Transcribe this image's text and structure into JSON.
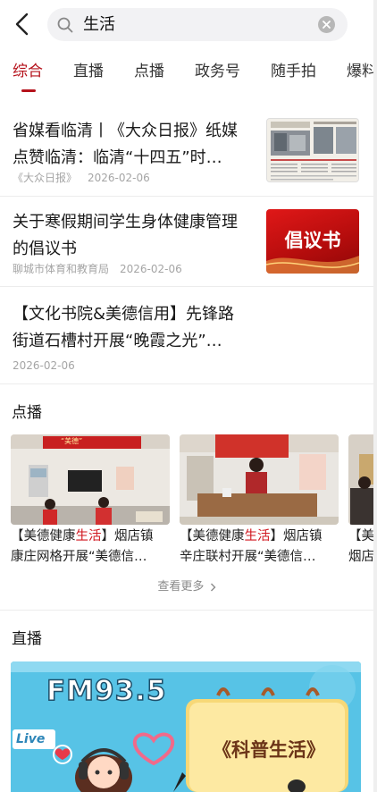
{
  "search": {
    "query": "生活"
  },
  "tabs": [
    {
      "label": "综合"
    },
    {
      "label": "直播"
    },
    {
      "label": "点播"
    },
    {
      "label": "政务号"
    },
    {
      "label": "随手拍"
    },
    {
      "label": "爆料"
    }
  ],
  "news": [
    {
      "title_line1": "省媒看临清丨《大众日报》纸媒",
      "title_line2": "点赞临清：临清“十四五”时…",
      "source": "《大众日报》",
      "date": "2026-02-06"
    },
    {
      "title_line1": "关于寒假期间学生身体健康管理",
      "title_line2": "的倡议书",
      "source": "聊城市体育和教育局",
      "date": "2026-02-06",
      "thumb_text": "倡议书"
    },
    {
      "title_line1": "【文化书院&美德信用】先锋路",
      "title_line2": "街道石槽村开展“晚霞之光”…",
      "date": "2026-02-06"
    }
  ],
  "vod": {
    "heading": "点播",
    "more_label": "查看更多",
    "items": [
      {
        "prefix": "【美德健康",
        "highlight": "生活",
        "suffix": "】烟店镇",
        "line2": "康庄网格开展“美德信…",
        "banner": "“美德”"
      },
      {
        "prefix": "【美德健康",
        "highlight": "生活",
        "suffix": "】烟店镇",
        "line2": "辛庄联村开展“美德信…"
      },
      {
        "prefix": "【美",
        "highlight": "",
        "suffix": "",
        "line2": "烟店"
      }
    ]
  },
  "live": {
    "heading": "直播",
    "freq": "FM93.5",
    "program": "《科普生活》",
    "tag": "Live"
  },
  "colors": {
    "accent": "#b5121b",
    "highlight": "#d0161e"
  }
}
